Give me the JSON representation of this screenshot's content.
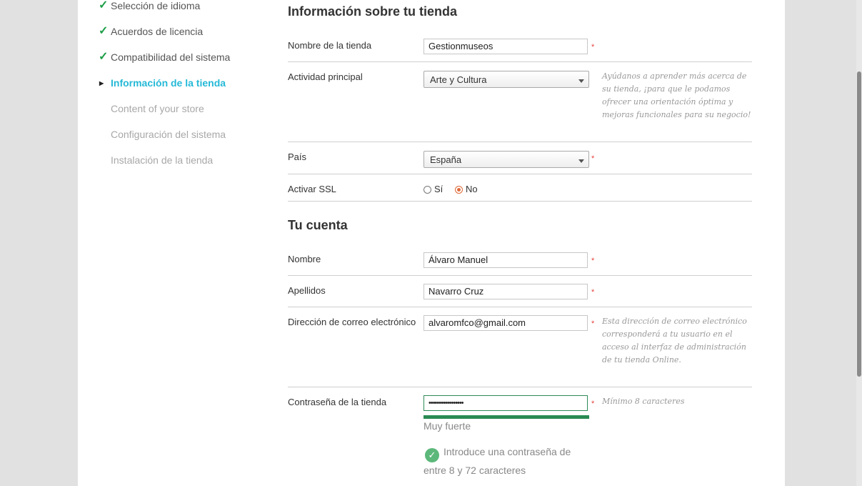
{
  "steps": [
    {
      "label": "Selección de idioma",
      "state": "done"
    },
    {
      "label": "Acuerdos de licencia",
      "state": "done"
    },
    {
      "label": "Compatibilidad del sistema",
      "state": "done"
    },
    {
      "label": "Información de la tienda",
      "state": "active"
    },
    {
      "label": "Content of your store",
      "state": "todo"
    },
    {
      "label": "Configuración del sistema",
      "state": "todo"
    },
    {
      "label": "Instalación de la tienda",
      "state": "todo"
    }
  ],
  "store_section": {
    "title": "Información sobre tu tienda",
    "store_name": {
      "label": "Nombre de la tienda",
      "value": "Gestionmuseos"
    },
    "activity": {
      "label": "Actividad principal",
      "value": "Arte y Cultura",
      "help": "Ayúdanos a aprender más acerca de su tienda, ¡para que le podamos ofrecer una orientación óptima y mejoras funcionales para su negocio!"
    },
    "country": {
      "label": "País",
      "value": "España"
    },
    "ssl": {
      "label": "Activar SSL",
      "options": [
        "Sí",
        "No"
      ],
      "selected": "No"
    }
  },
  "account_section": {
    "title": "Tu cuenta",
    "first_name": {
      "label": "Nombre",
      "value": "Álvaro Manuel"
    },
    "last_name": {
      "label": "Apellidos",
      "value": "Navarro Cruz"
    },
    "email": {
      "label": "Dirección de correo electrónico",
      "value": "alvaromfco@gmail.com",
      "help": "Esta dirección de correo electrónico corresponderá a tu usuario en el acceso al interfaz de administración de tu tienda Online."
    },
    "password": {
      "label": "Contraseña de la tienda",
      "value": "•••••••••••••••••",
      "help": "Mínimo 8 caracteres",
      "strength": "Muy fuerte",
      "strength_level": 1.0,
      "validation": "Introduce una contraseña de entre 8 y 72 caracteres"
    }
  },
  "required_mark": "*",
  "colors": {
    "active_step": "#25b9d7",
    "done_check": "#1e9e47",
    "required": "#e8413c",
    "strength_bar": "#2a8a52",
    "radio_selected": "#e06a3a"
  }
}
